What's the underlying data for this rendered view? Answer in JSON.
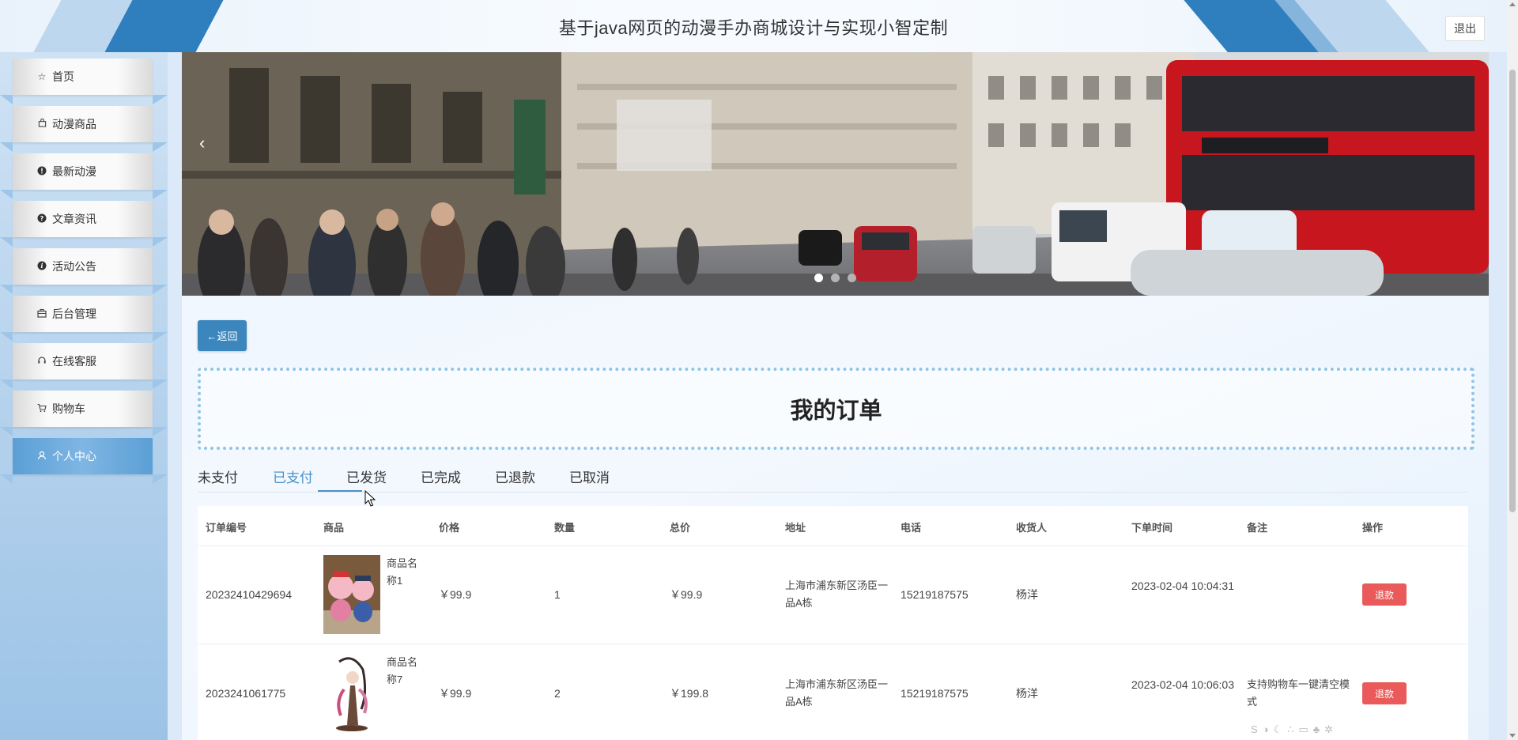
{
  "header": {
    "title": "基于java网页的动漫手办商城设计与实现小智定制",
    "logout_label": "退出"
  },
  "sidebar": {
    "items": [
      {
        "label": "首页",
        "icon": "star-outline-icon"
      },
      {
        "label": "动漫商品",
        "icon": "bag-icon"
      },
      {
        "label": "最新动漫",
        "icon": "exclamation-circle-icon"
      },
      {
        "label": "文章资讯",
        "icon": "question-circle-icon"
      },
      {
        "label": "活动公告",
        "icon": "info-circle-icon"
      },
      {
        "label": "后台管理",
        "icon": "briefcase-icon"
      },
      {
        "label": "在线客服",
        "icon": "headset-icon"
      },
      {
        "label": "购物车",
        "icon": "cart-icon"
      },
      {
        "label": "个人中心",
        "icon": "user-icon"
      }
    ],
    "active_index": 8
  },
  "banner": {
    "slide_count": 3,
    "active_slide": 1
  },
  "back_button": {
    "label": "←返回"
  },
  "page_title": "我的订单",
  "tabs": [
    {
      "label": "未支付"
    },
    {
      "label": "已支付"
    },
    {
      "label": "已发货"
    },
    {
      "label": "已完成"
    },
    {
      "label": "已退款"
    },
    {
      "label": "已取消"
    }
  ],
  "active_tab": "已支付",
  "table": {
    "headers": [
      "订单编号",
      "商品",
      "价格",
      "数量",
      "总价",
      "地址",
      "电话",
      "收货人",
      "下单时间",
      "备注",
      "操作"
    ],
    "rows": [
      {
        "order_no": "20232410429694",
        "product_name": "商品名称1",
        "product_image": "pig-figure-image",
        "price": "￥99.9",
        "quantity": "1",
        "total": "￥99.9",
        "address": "上海市浦东新区汤臣一品A栋",
        "phone": "15219187575",
        "receiver": "杨洋",
        "order_time": "2023-02-04 10:04:31",
        "note": "",
        "action": "退款"
      },
      {
        "order_no": "2023241061775",
        "product_name": "商品名称7",
        "product_image": "anime-figure-image",
        "price": "￥99.9",
        "quantity": "2",
        "total": "￥199.8",
        "address": "上海市浦东新区汤臣一品A栋",
        "phone": "15219187575",
        "receiver": "杨洋",
        "order_time": "2023-02-04 10:06:03",
        "note": "支持购物车一键清空模式",
        "action": "退款"
      }
    ]
  },
  "colors": {
    "accent": "#4a90c8",
    "refund": "#ea5a5a",
    "header_deco": "#2f7fbf"
  }
}
